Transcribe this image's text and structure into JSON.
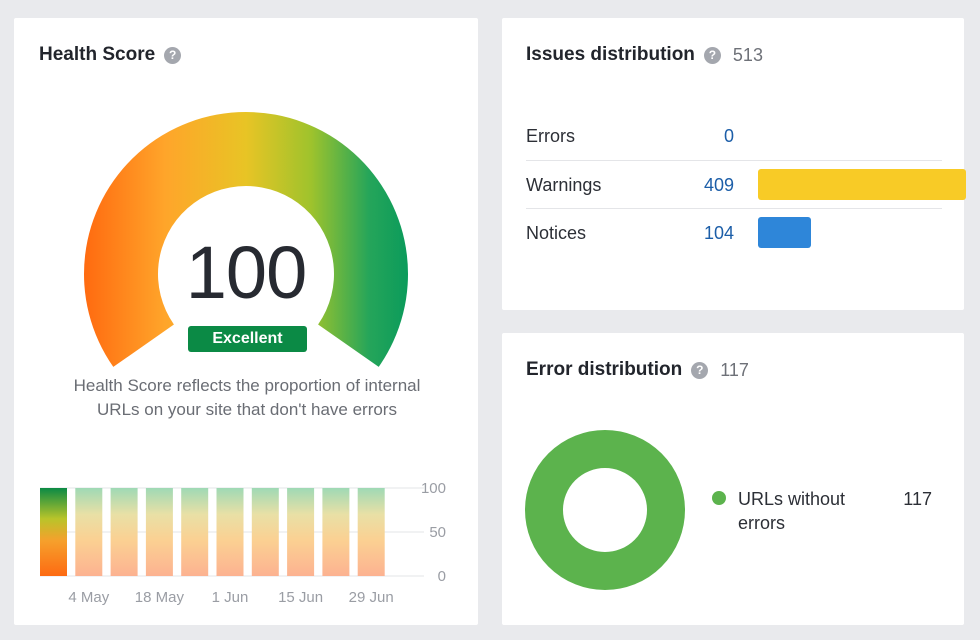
{
  "health": {
    "title": "Health Score",
    "help_icon": "question-circle-icon",
    "score": "100",
    "badge": "Excellent",
    "description": "Health Score reflects the proportion of internal URLs on your site that don't have errors",
    "gauge_colors": [
      "#ff6a10",
      "#ffa52a",
      "#e8c425",
      "#9fc32c",
      "#25a55a",
      "#0b9b5b"
    ],
    "badge_color": "#0b8a45"
  },
  "chart_data": {
    "type": "bar",
    "title": "",
    "categories": [
      "",
      "4 May",
      "",
      "18 May",
      "",
      "1 Jun",
      "",
      "15 Jun",
      "",
      "29 Jun"
    ],
    "values": [
      100,
      100,
      100,
      100,
      100,
      100,
      100,
      100,
      100,
      100
    ],
    "ylim": [
      0,
      100
    ],
    "yticks": [
      "0",
      "50",
      "100"
    ],
    "xtick_labels": [
      "4 May",
      "18 May",
      "1 Jun",
      "15 Jun",
      "29 Jun"
    ],
    "grid": true,
    "highlighted_index": 0
  },
  "issues": {
    "title": "Issues distribution",
    "help_icon": "question-circle-icon",
    "total": "513",
    "rows": [
      {
        "label": "Errors",
        "count": "0",
        "value": 0,
        "color": "#e0453a"
      },
      {
        "label": "Warnings",
        "count": "409",
        "value": 409,
        "color": "#f8cb26"
      },
      {
        "label": "Notices",
        "count": "104",
        "value": 104,
        "color": "#2e86d9"
      }
    ]
  },
  "error_distribution": {
    "title": "Error distribution",
    "help_icon": "question-circle-icon",
    "total": "117",
    "legend": [
      {
        "label": "URLs without errors",
        "value": "117",
        "color": "#5cb34d"
      }
    ]
  }
}
